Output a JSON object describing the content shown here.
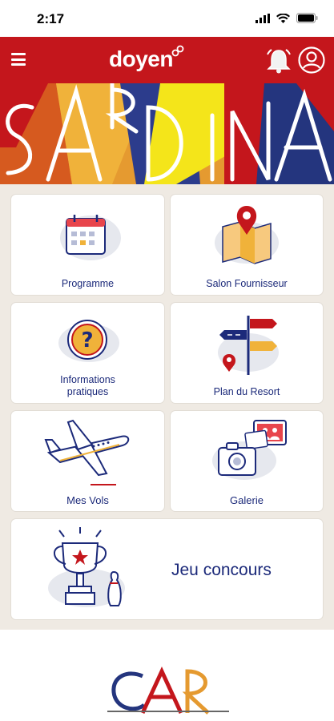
{
  "status_bar": {
    "time": "2:17"
  },
  "header": {
    "brand": "doyen"
  },
  "banner": {
    "letters": [
      "S",
      "A",
      "R",
      "D",
      "I",
      "N",
      "A"
    ]
  },
  "cards": {
    "programme": "Programme",
    "salon": "Salon Fournisseur",
    "infos_line1": "Informations",
    "infos_line2": "pratiques",
    "plan": "Plan du Resort",
    "vols": "Mes Vols",
    "galerie": "Galerie",
    "jeu": "Jeu concours"
  },
  "footer": {
    "logo": "CAR"
  },
  "colors": {
    "brand_red": "#c4161c",
    "text_navy": "#1c2a7a",
    "bg_beige": "#efeae3"
  },
  "icons": [
    "menu-icon",
    "bell-icon",
    "account-icon",
    "calendar-icon",
    "map-icon",
    "question-icon",
    "signpost-icon",
    "plane-icon",
    "camera-icon",
    "trophy-icon"
  ]
}
